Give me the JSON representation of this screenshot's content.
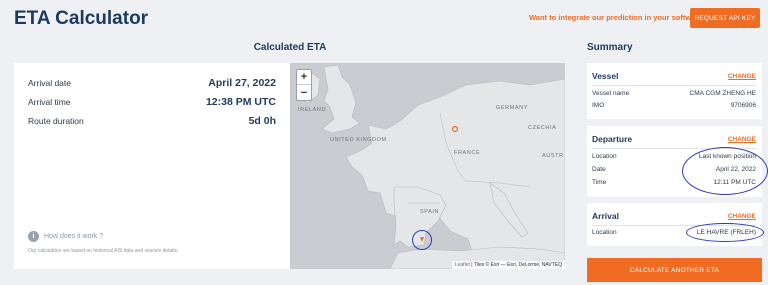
{
  "header": {
    "title": "ETA Calculator",
    "promo": "Want to integrate our prediction in your software?",
    "api_button": "REQUEST API KEY"
  },
  "eta": {
    "heading": "Calculated ETA",
    "arrival_date_label": "Arrival date",
    "arrival_date": "April 27, 2022",
    "arrival_time_label": "Arrival time",
    "arrival_time": "12:38 PM UTC",
    "route_duration_label": "Route duration",
    "route_duration": "5d 0h",
    "how_link": "How does it work ?",
    "note": "Our calculation are based on historical AIS data and vessels details."
  },
  "map": {
    "zoom_in": "+",
    "zoom_out": "−",
    "labels": {
      "ireland": "IRELAND",
      "uk": "UNITED KINGDOM",
      "germany": "GERMANY",
      "czechia": "CZECHIA",
      "france": "FRANCE",
      "austria": "AUSTR",
      "spain": "SPAIN"
    },
    "attribution_link": "Leaflet",
    "attribution_text": "| Tiles © Esri — Esri, DeLorme, NAVTEQ"
  },
  "summary": {
    "heading": "Summary",
    "change_label": "CHANGE",
    "vessel": {
      "title": "Vessel",
      "name_label": "Vessel name",
      "name": "CMA CGM ZHENG HE",
      "imo_label": "IMO",
      "imo": "9706906"
    },
    "departure": {
      "title": "Departure",
      "location_label": "Location",
      "location": "Last known position",
      "date_label": "Date",
      "date": "April 22, 2022",
      "time_label": "Time",
      "time": "12:11 PM UTC"
    },
    "arrival": {
      "title": "Arrival",
      "location_label": "Location",
      "location": "LE HAVRE (FRLEH)"
    },
    "calculate_button": "CALCULATE ANOTHER ETA"
  },
  "colors": {
    "accent": "#f06c22",
    "navy": "#1d3a5c",
    "annotation": "#2a3bb8"
  }
}
